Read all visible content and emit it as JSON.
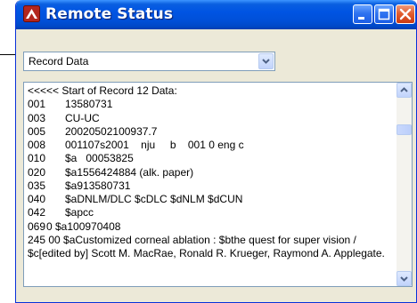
{
  "window": {
    "title": "Remote Status",
    "icons": {
      "app": "maps-remote-icon",
      "minimize": "minimize-icon",
      "maximize": "maximize-icon",
      "close": "close-icon"
    }
  },
  "dropdown": {
    "selected": "Record Data",
    "icon": "chevron-down-icon"
  },
  "record": {
    "header": "<<<<< Start of Record 12 Data:",
    "fields": [
      {
        "tag": "001",
        "ind": "",
        "value": "13580731"
      },
      {
        "tag": "003",
        "ind": "",
        "value": "CU-UC"
      },
      {
        "tag": "005",
        "ind": "",
        "value": "20020502100937.7"
      },
      {
        "tag": "008",
        "ind": "",
        "value": "001107s2001    nju     b    001 0 eng c"
      },
      {
        "tag": "010",
        "ind": "",
        "value": "$a   00053825"
      },
      {
        "tag": "020",
        "ind": "",
        "value": "$a1556424884 (alk. paper)"
      },
      {
        "tag": "035",
        "ind": "",
        "value": "$a913580731"
      },
      {
        "tag": "040",
        "ind": "",
        "value": "$aDNLM/DLC $cDLC $dNLM $dCUN"
      },
      {
        "tag": "042",
        "ind": "",
        "value": "$apcc"
      },
      {
        "tag": "069",
        "ind": "0",
        "value": "$a100970408"
      }
    ],
    "field245": "245 00  $aCustomized corneal ablation : $bthe quest for super vision / $c[edited by] Scott M. MacRae, Ronald R. Krueger, Raymond A. Applegate."
  },
  "scrollbar": {
    "up_icon": "scroll-up-arrow-icon",
    "down_icon": "scroll-down-arrow-icon"
  }
}
